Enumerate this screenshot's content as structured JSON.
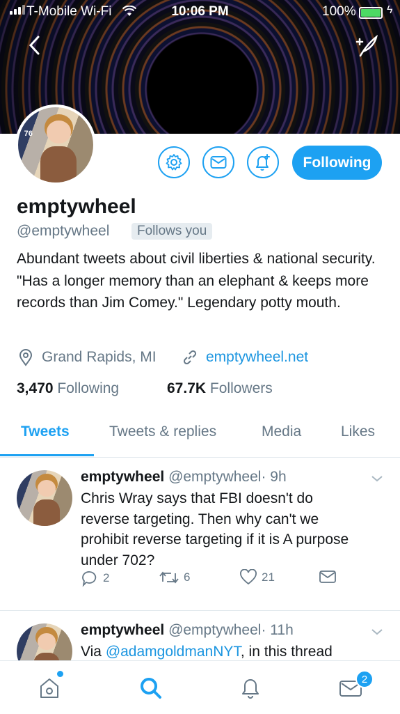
{
  "status_bar": {
    "carrier": "T-Mobile Wi-Fi",
    "time": "10:06 PM",
    "battery": "100%"
  },
  "profile": {
    "name": "emptywheel",
    "handle": "@emptywheel",
    "follows_you": "Follows you",
    "bio": "Abundant tweets about civil liberties & national security. \"Has a longer memory than an elephant & keeps more records than Jim Comey.\" Legendary potty mouth.",
    "location": "Grand Rapids, MI",
    "website": "emptywheel.net",
    "following_count": "3,470",
    "following_label": "Following",
    "followers_count": "67.7K",
    "followers_label": "Followers",
    "follow_button": "Following",
    "avatar_number": "76"
  },
  "tabs": [
    "Tweets",
    "Tweets & replies",
    "Media",
    "Likes"
  ],
  "tweets": [
    {
      "name": "emptywheel",
      "handle": "@emptywheel",
      "time": "· 9h",
      "text": "Chris Wray says that FBI doesn't do reverse targeting. Then why can't we prohibit reverse targeting if it is A purpose under 702?",
      "replies": "2",
      "retweets": "6",
      "likes": "21"
    },
    {
      "name": "emptywheel",
      "handle": "@emptywheel",
      "time": "· 11h",
      "text_prefix": "Via ",
      "mention": "@adamgoldmanNYT",
      "text_suffix": ", in this thread"
    }
  ],
  "bottom_nav": {
    "messages_badge": "2"
  },
  "colors": {
    "accent": "#1da1f2",
    "secondary_text": "#657786",
    "divider": "#e1e8ed"
  }
}
